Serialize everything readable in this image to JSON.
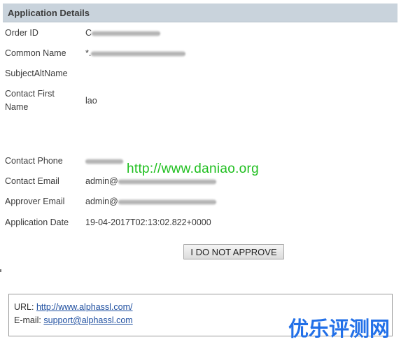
{
  "panel": {
    "title": "Application Details"
  },
  "fields": {
    "order_id": {
      "label": "Order ID",
      "value": "C"
    },
    "common_name": {
      "label": "Common Name",
      "value": "*."
    },
    "subject_alt_name": {
      "label": "SubjectAltName",
      "value": ""
    },
    "contact_first_name": {
      "label": "Contact First Name",
      "value": "lao"
    },
    "contact_phone": {
      "label": "Contact Phone",
      "value": ""
    },
    "contact_email": {
      "label": "Contact Email",
      "value": "admin@"
    },
    "approver_email": {
      "label": "Approver Email",
      "value": "admin@"
    },
    "application_date": {
      "label": "Application Date",
      "value": "19-04-2017T02:13:02.822+0000"
    }
  },
  "watermark": {
    "text": "http://www.daniao.org"
  },
  "actions": {
    "not_approve_label": "I DO NOT APPROVE"
  },
  "footer": {
    "url_label": "URL:",
    "url_link": "http://www.alphassl.com/",
    "email_label": "E-mail:",
    "email_link": "support@alphassl.com"
  },
  "logo": {
    "text": "优乐评测网"
  },
  "colors": {
    "header_bg": "#c9d3dc",
    "watermark": "#1fbf1f",
    "link": "#1f4fa0",
    "logo": "#2270e8"
  }
}
